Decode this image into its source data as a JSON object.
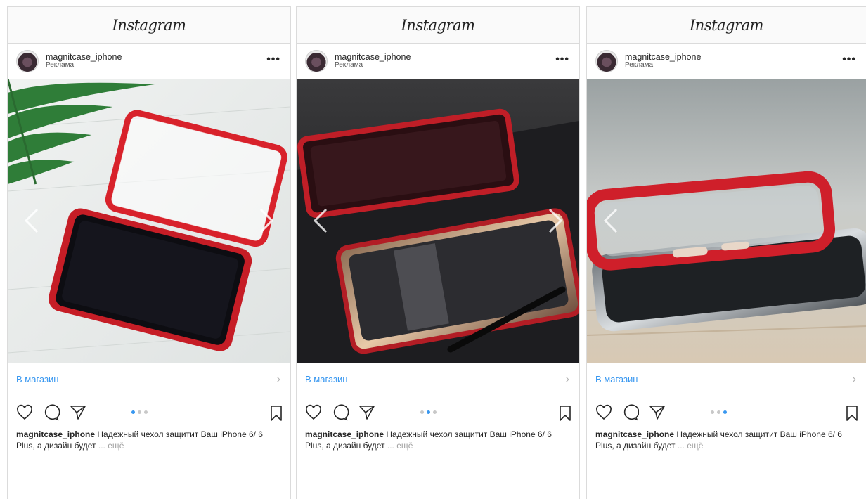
{
  "header": {
    "logo_text": "Instagram"
  },
  "posts": [
    {
      "username": "magnitcase_iphone",
      "sponsored": "Реклама",
      "more_label": "•••",
      "shop_label": "В магазин",
      "caption_user": "magnitcase_iphone",
      "caption_text": " Надежный чехол защитит Ваш iPhone 6/ 6 Plus, а дизайн будет ",
      "caption_more": "... ещё",
      "active_slide": 1,
      "slide_count": 3
    },
    {
      "username": "magnitcase_iphone",
      "sponsored": "Реклама",
      "more_label": "•••",
      "shop_label": "В магазин",
      "caption_user": "magnitcase_iphone",
      "caption_text": " Надежный чехол защитит Ваш iPhone 6/ 6 Plus, а дизайн будет ",
      "caption_more": "... ещё",
      "active_slide": 2,
      "slide_count": 3
    },
    {
      "username": "magnitcase_iphone",
      "sponsored": "Реклама",
      "more_label": "•••",
      "shop_label": "В магазин",
      "caption_user": "magnitcase_iphone",
      "caption_text": " Надежный чехол защитит Ваш iPhone 6/ 6 Plus, а дизайн будет ",
      "caption_more": "... ещё",
      "active_slide": 3,
      "slide_count": 3
    }
  ],
  "icons": [
    "heart-icon",
    "comment-icon",
    "share-icon",
    "bookmark-icon",
    "chevron-right-icon",
    "chevron-left-icon",
    "more-icon"
  ],
  "colors": {
    "link": "#3897f0",
    "border": "#dbdbdb",
    "case_red": "#d8222b",
    "dot_inactive": "#c8c8c8"
  }
}
